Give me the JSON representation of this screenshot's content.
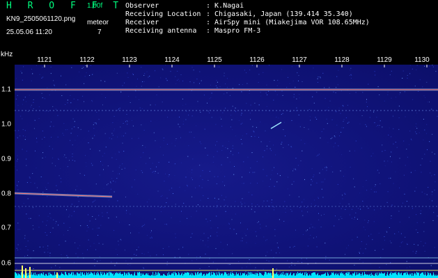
{
  "header": {
    "title": "H R O F F T",
    "version": "1.00f",
    "filename": "KN9_2505061120.png",
    "mode": "meteor",
    "count": "7",
    "datetime": "25.05.06 11:20"
  },
  "info": [
    {
      "label": "Observer",
      "value": ": K.Nagai"
    },
    {
      "label": "Receiving Location",
      "value": ": Chigasaki, Japan (139.414 35.340)"
    },
    {
      "label": "Receiver",
      "value": ": AirSpy mini (Miakejima VOR 108.65MHz)"
    },
    {
      "label": "Receiving antenna",
      "value": ": Maspro FM-3"
    }
  ],
  "axis": {
    "unit": "kHz",
    "x_ticks": [
      "1121",
      "1122",
      "1123",
      "1124",
      "1125",
      "1126",
      "1127",
      "1128",
      "1129",
      "1130"
    ],
    "y_ticks": [
      "1.1",
      "1.0",
      "0.9",
      "0.8",
      "0.7",
      "0.6"
    ]
  },
  "colors": {
    "background": "#10137a",
    "carrier": "#ff3b3b",
    "echo": "#ffff66",
    "baseline": "#00e5ff",
    "text": "#ffffff",
    "title": "#00ff7f"
  }
}
